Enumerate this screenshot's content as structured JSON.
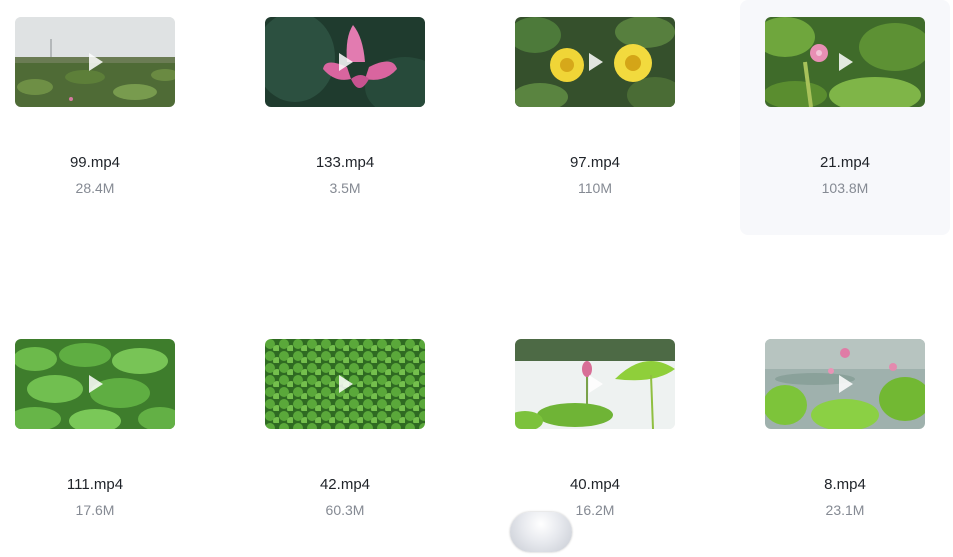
{
  "files": [
    {
      "name": "99.mp4",
      "size": "28.4M",
      "thumb": "lotus-field-thumbnail"
    },
    {
      "name": "133.mp4",
      "size": "3.5M",
      "thumb": "pink-lotus-thumbnail"
    },
    {
      "name": "97.mp4",
      "size": "110M",
      "thumb": "yellow-water-lilies-thumbnail"
    },
    {
      "name": "21.mp4",
      "size": "103.8M",
      "thumb": "pink-lotus-bud-thumbnail"
    },
    {
      "name": "111.mp4",
      "size": "17.6M",
      "thumb": "lotus-leaves-thumbnail"
    },
    {
      "name": "42.mp4",
      "size": "60.3M",
      "thumb": "floating-leaves-thumbnail"
    },
    {
      "name": "40.mp4",
      "size": "16.2M",
      "thumb": "lotus-over-water-thumbnail"
    },
    {
      "name": "8.mp4",
      "size": "23.1M",
      "thumb": "lotus-pond-thumbnail"
    }
  ],
  "icons": {
    "play": "play-icon"
  },
  "colors": {
    "filename": "#1f2329",
    "filesize": "#858a93",
    "hover_bg": "#f7f8fb"
  }
}
